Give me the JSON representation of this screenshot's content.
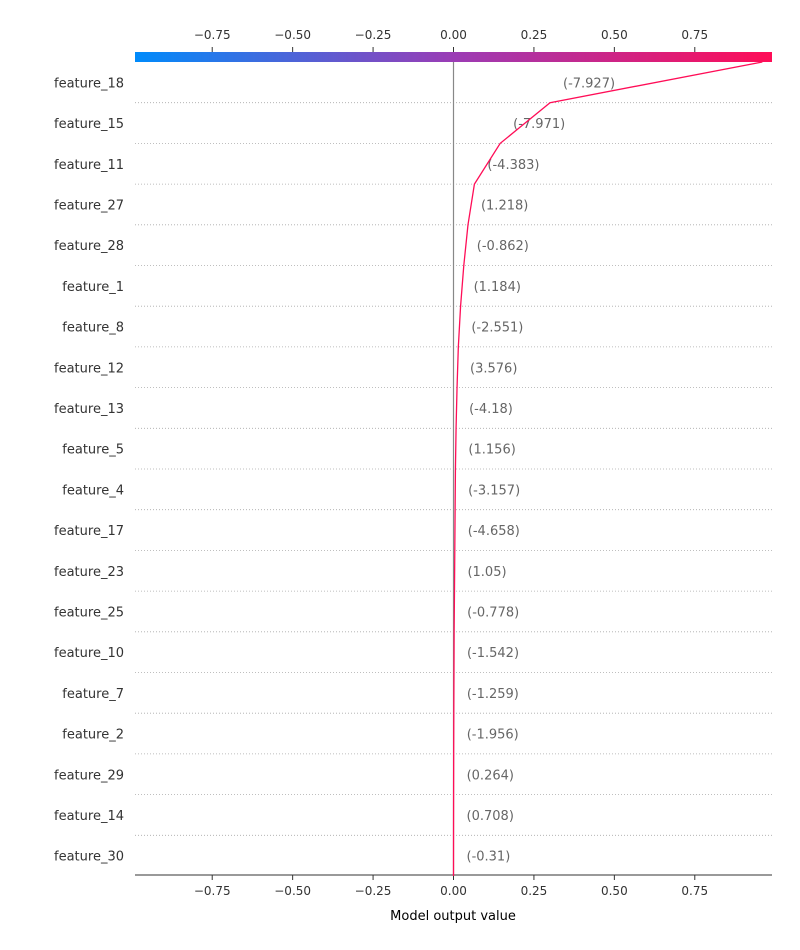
{
  "chart_data": {
    "type": "line",
    "title": "",
    "xlabel": "Model output value",
    "ylabel": "",
    "xlim": [
      -0.99,
      0.99
    ],
    "base_value": 0.0,
    "grid": false,
    "colors": {
      "line": "#ff0d57",
      "colorbar_low": "#008bfb",
      "colorbar_mid": "#9b3cb5",
      "colorbar_high": "#ff0d57",
      "base_line": "#888888",
      "row_grid": "#aaaaaa",
      "text": "#333333",
      "value_text": "#666666"
    },
    "x_ticks": [
      -0.75,
      -0.5,
      -0.25,
      0.0,
      0.25,
      0.5,
      0.75
    ],
    "x_tick_labels": [
      "−0.75",
      "−0.50",
      "−0.25",
      "0.00",
      "0.25",
      "0.50",
      "0.75"
    ],
    "final_value": 0.96,
    "features": [
      {
        "name": "feature_18",
        "feature_value": "(-7.927)",
        "cumulative_output": 0.3
      },
      {
        "name": "feature_15",
        "feature_value": "(-7.971)",
        "cumulative_output": 0.145
      },
      {
        "name": "feature_11",
        "feature_value": "(-4.383)",
        "cumulative_output": 0.065
      },
      {
        "name": "feature_27",
        "feature_value": "(1.218)",
        "cumulative_output": 0.045
      },
      {
        "name": "feature_28",
        "feature_value": "(-0.862)",
        "cumulative_output": 0.032
      },
      {
        "name": "feature_1",
        "feature_value": "(1.184)",
        "cumulative_output": 0.022
      },
      {
        "name": "feature_8",
        "feature_value": "(-2.551)",
        "cumulative_output": 0.015
      },
      {
        "name": "feature_12",
        "feature_value": "(3.576)",
        "cumulative_output": 0.011
      },
      {
        "name": "feature_13",
        "feature_value": "(-4.18)",
        "cumulative_output": 0.008
      },
      {
        "name": "feature_5",
        "feature_value": "(1.156)",
        "cumulative_output": 0.006
      },
      {
        "name": "feature_4",
        "feature_value": "(-3.157)",
        "cumulative_output": 0.005
      },
      {
        "name": "feature_17",
        "feature_value": "(-4.658)",
        "cumulative_output": 0.004
      },
      {
        "name": "feature_23",
        "feature_value": "(1.05)",
        "cumulative_output": 0.003
      },
      {
        "name": "feature_25",
        "feature_value": "(-0.778)",
        "cumulative_output": 0.002
      },
      {
        "name": "feature_10",
        "feature_value": "(-1.542)",
        "cumulative_output": 0.0015
      },
      {
        "name": "feature_7",
        "feature_value": "(-1.259)",
        "cumulative_output": 0.001
      },
      {
        "name": "feature_2",
        "feature_value": "(-1.956)",
        "cumulative_output": 0.0006
      },
      {
        "name": "feature_29",
        "feature_value": "(0.264)",
        "cumulative_output": 0.0003
      },
      {
        "name": "feature_14",
        "feature_value": "(0.708)",
        "cumulative_output": 0.0001
      },
      {
        "name": "feature_30",
        "feature_value": "(-0.31)",
        "cumulative_output": 0.0
      }
    ]
  }
}
